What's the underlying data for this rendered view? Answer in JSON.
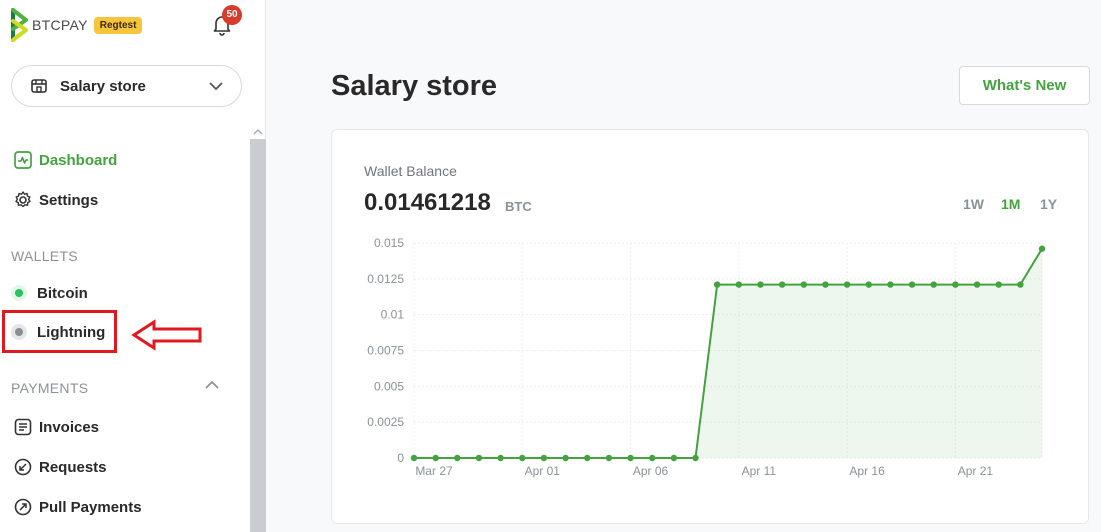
{
  "brand": {
    "name": "BTCPAY",
    "badge": "Regtest",
    "colors": {
      "logo_green": "#51b13e",
      "logo_yellow": "#cedc21",
      "logo_dark": "#1e7a44"
    }
  },
  "notifications": {
    "count": "50",
    "icon": "bell-icon"
  },
  "store": {
    "name": "Salary store",
    "icon": "store-icon"
  },
  "nav": {
    "dashboard": "Dashboard",
    "settings": "Settings",
    "wallets_header": "WALLETS",
    "bitcoin": "Bitcoin",
    "lightning": "Lightning",
    "payments_header": "PAYMENTS",
    "invoices": "Invoices",
    "requests": "Requests",
    "pull_payments": "Pull Payments"
  },
  "main": {
    "title": "Salary store",
    "whats_new": "What's New"
  },
  "wallet": {
    "label": "Wallet Balance",
    "value": "0.01461218",
    "unit": "BTC",
    "ranges": [
      "1W",
      "1M",
      "1Y"
    ],
    "active_range": "1M"
  },
  "colors": {
    "accent": "#44a340",
    "annotation_red": "#e0181f",
    "bitcoin_status": "#22c55e",
    "lightning_status": "#8a8f94"
  },
  "chart_data": {
    "type": "area",
    "title": "",
    "xlabel": "",
    "ylabel": "",
    "ylim": [
      0,
      0.015
    ],
    "yticks": [
      "0",
      "0.0025",
      "0.005",
      "0.0075",
      "0.01",
      "0.0125",
      "0.015"
    ],
    "xtick_labels": [
      "Mar 27",
      "Apr 01",
      "Apr 06",
      "Apr 11",
      "Apr 16",
      "Apr 21"
    ],
    "x": [
      "Mar 27",
      "Mar 28",
      "Mar 29",
      "Mar 30",
      "Mar 31",
      "Apr 01",
      "Apr 02",
      "Apr 03",
      "Apr 04",
      "Apr 05",
      "Apr 06",
      "Apr 07",
      "Apr 08",
      "Apr 09",
      "Apr 10",
      "Apr 11",
      "Apr 12",
      "Apr 13",
      "Apr 14",
      "Apr 15",
      "Apr 16",
      "Apr 17",
      "Apr 18",
      "Apr 19",
      "Apr 20",
      "Apr 21",
      "Apr 22",
      "Apr 23",
      "Apr 24",
      "Apr 25"
    ],
    "values": [
      0,
      0,
      0,
      0,
      0,
      0,
      0,
      0,
      0,
      0,
      0,
      0,
      0,
      0,
      0.0121,
      0.0121,
      0.0121,
      0.0121,
      0.0121,
      0.0121,
      0.0121,
      0.0121,
      0.0121,
      0.0121,
      0.0121,
      0.0121,
      0.0121,
      0.0121,
      0.0121,
      0.0146
    ],
    "grid": true,
    "line_color": "#44a340"
  }
}
